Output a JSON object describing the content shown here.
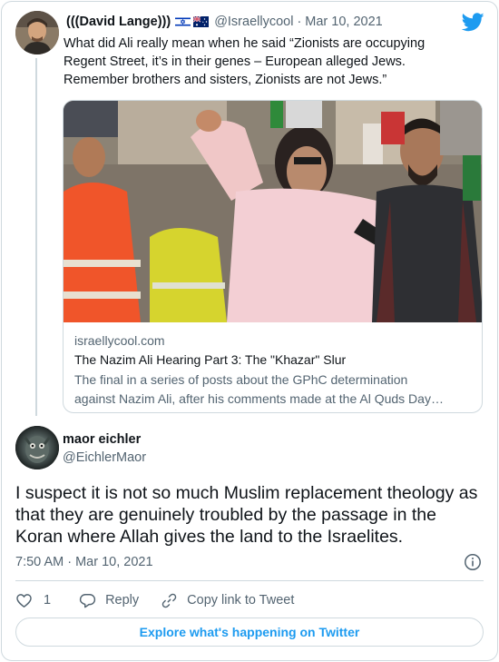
{
  "quoted_tweet": {
    "name": "(((David Lange)))",
    "flags": [
      "israel-flag-icon",
      "australia-flag-icon"
    ],
    "handle": "@Israellycool",
    "separator": "·",
    "date": "Mar 10, 2021",
    "text": "What did Ali really mean when he said “Zionists are occupying Regent Street, it’s in their genes – European alleged Jews. Remember brothers and sisters, Zionists are not Jews.”",
    "link_card": {
      "domain": "israellycool.com",
      "title": "The Nazim Ali Hearing Part 3: The \"Khazar\" Slur",
      "description_line1": "The final in a series of posts about the GPhC determination",
      "description_line2": "against Nazim Ali, after his comments made at the Al Quds Day…"
    }
  },
  "tweet": {
    "name": "maor eichler",
    "handle": "@EichlerMaor",
    "text": "I suspect it is not so much Muslim replacement theology as that they are genuinely troubled by the passage in the Koran where Allah gives the land to the Israelites.",
    "timestamp": "7:50 AM · Mar 10, 2021",
    "like_count": "1",
    "reply_label": "Reply",
    "copy_link_label": "Copy link to Tweet"
  },
  "footer": {
    "explore_label": "Explore what's happening on Twitter"
  },
  "colors": {
    "brand": "#1d9bf0",
    "text": "#0f1419",
    "secondary": "#536471",
    "border": "#cfd9de"
  },
  "icons": [
    "twitter-bird-icon",
    "info-icon",
    "heart-icon",
    "reply-icon",
    "link-icon"
  ]
}
